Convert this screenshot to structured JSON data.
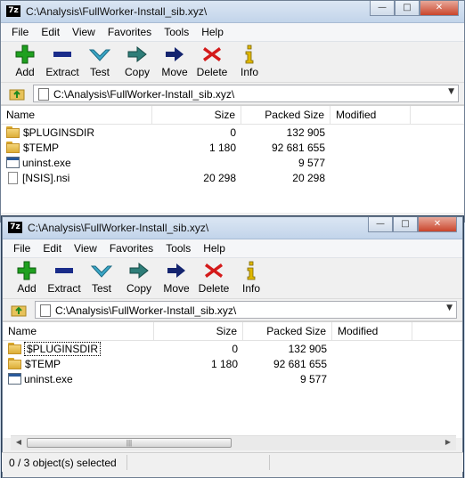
{
  "window_back": {
    "title": "C:\\Analysis\\FullWorker-Install_sib.xyz\\",
    "app_icon_text": "7z",
    "menu": [
      "File",
      "Edit",
      "View",
      "Favorites",
      "Tools",
      "Help"
    ],
    "toolbar": [
      "Add",
      "Extract",
      "Test",
      "Copy",
      "Move",
      "Delete",
      "Info"
    ],
    "address": "C:\\Analysis\\FullWorker-Install_sib.xyz\\",
    "columns": [
      "Name",
      "Size",
      "Packed Size",
      "Modified"
    ],
    "rows": [
      {
        "name": "$PLUGINSDIR",
        "size": "0",
        "packed": "132 905",
        "modified": "",
        "icon": "folder-icon"
      },
      {
        "name": "$TEMP",
        "size": "1 180",
        "packed": "92 681 655",
        "modified": "",
        "icon": "folder-icon"
      },
      {
        "name": "uninst.exe",
        "size": "",
        "packed": "9 577",
        "modified": "",
        "icon": "exe-icon"
      },
      {
        "name": "[NSIS].nsi",
        "size": "20 298",
        "packed": "20 298",
        "modified": "",
        "icon": "file-icon"
      }
    ]
  },
  "window_front": {
    "title": "C:\\Analysis\\FullWorker-Install_sib.xyz\\",
    "app_icon_text": "7z",
    "menu": [
      "File",
      "Edit",
      "View",
      "Favorites",
      "Tools",
      "Help"
    ],
    "toolbar": [
      "Add",
      "Extract",
      "Test",
      "Copy",
      "Move",
      "Delete",
      "Info"
    ],
    "address": "C:\\Analysis\\FullWorker-Install_sib.xyz\\",
    "columns": [
      "Name",
      "Size",
      "Packed Size",
      "Modified"
    ],
    "rows": [
      {
        "name": "$PLUGINSDIR",
        "size": "0",
        "packed": "132 905",
        "modified": "",
        "icon": "folder-icon"
      },
      {
        "name": "$TEMP",
        "size": "1 180",
        "packed": "92 681 655",
        "modified": "",
        "icon": "folder-icon"
      },
      {
        "name": "uninst.exe",
        "size": "",
        "packed": "9 577",
        "modified": "",
        "icon": "exe-icon"
      }
    ],
    "status": "0 / 3 object(s) selected"
  },
  "colors": {
    "add": "#1fa01f",
    "extract": "#1a2c8a",
    "test": "#3aa7c7",
    "copy": "#2e7d78",
    "move": "#14246f",
    "delete": "#d41a1a",
    "info": "#e0b800"
  }
}
